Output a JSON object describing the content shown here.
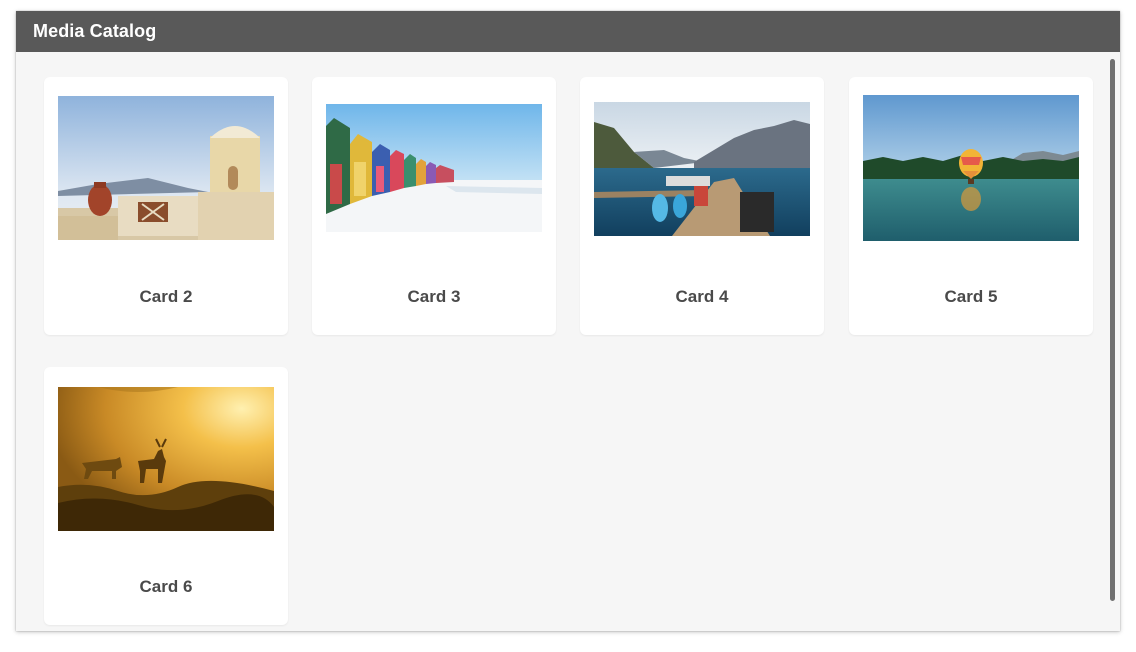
{
  "window": {
    "title": "Media Catalog"
  },
  "cards": [
    {
      "label": "Card 2",
      "image": "santorini-windmill-image"
    },
    {
      "label": "Card 3",
      "image": "beach-huts-image"
    },
    {
      "label": "Card 4",
      "image": "lake-dock-kayaks-image"
    },
    {
      "label": "Card 5",
      "image": "hot-air-balloon-lake-image"
    },
    {
      "label": "Card 6",
      "image": "deer-misty-sunrise-image"
    }
  ],
  "colors": {
    "titlebar": "#595959",
    "background": "#f6f6f6",
    "card": "#ffffff",
    "label": "#4a4a4a"
  }
}
